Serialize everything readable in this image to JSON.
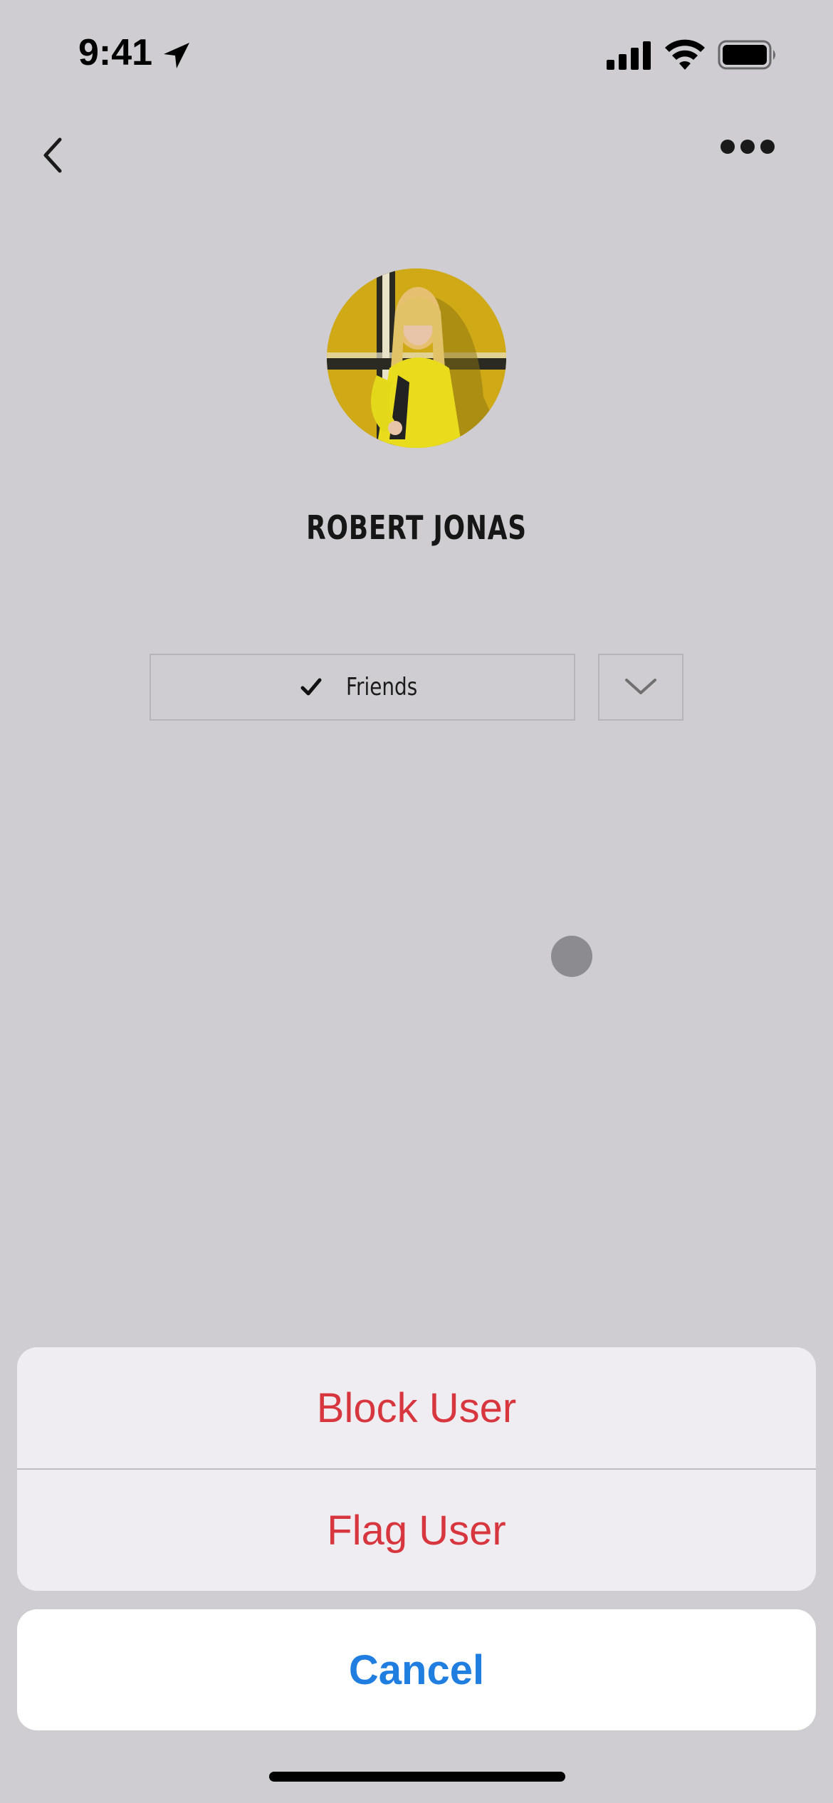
{
  "status_bar": {
    "time": "9:41"
  },
  "nav": {
    "back_icon": "chevron-left-icon",
    "more_icon": "ellipsis-icon"
  },
  "profile": {
    "name": "ROBERT JONAS",
    "friends_label": "Friends",
    "avatar_description_icon": "avatar"
  },
  "action_sheet": {
    "items": [
      {
        "label": "Block User"
      },
      {
        "label": "Flag User"
      }
    ],
    "cancel_label": "Cancel"
  },
  "colors": {
    "background": "#cfcdd1",
    "destructive": "#d8363f",
    "accent": "#1f7ee0",
    "sheet": "#efedf1"
  }
}
